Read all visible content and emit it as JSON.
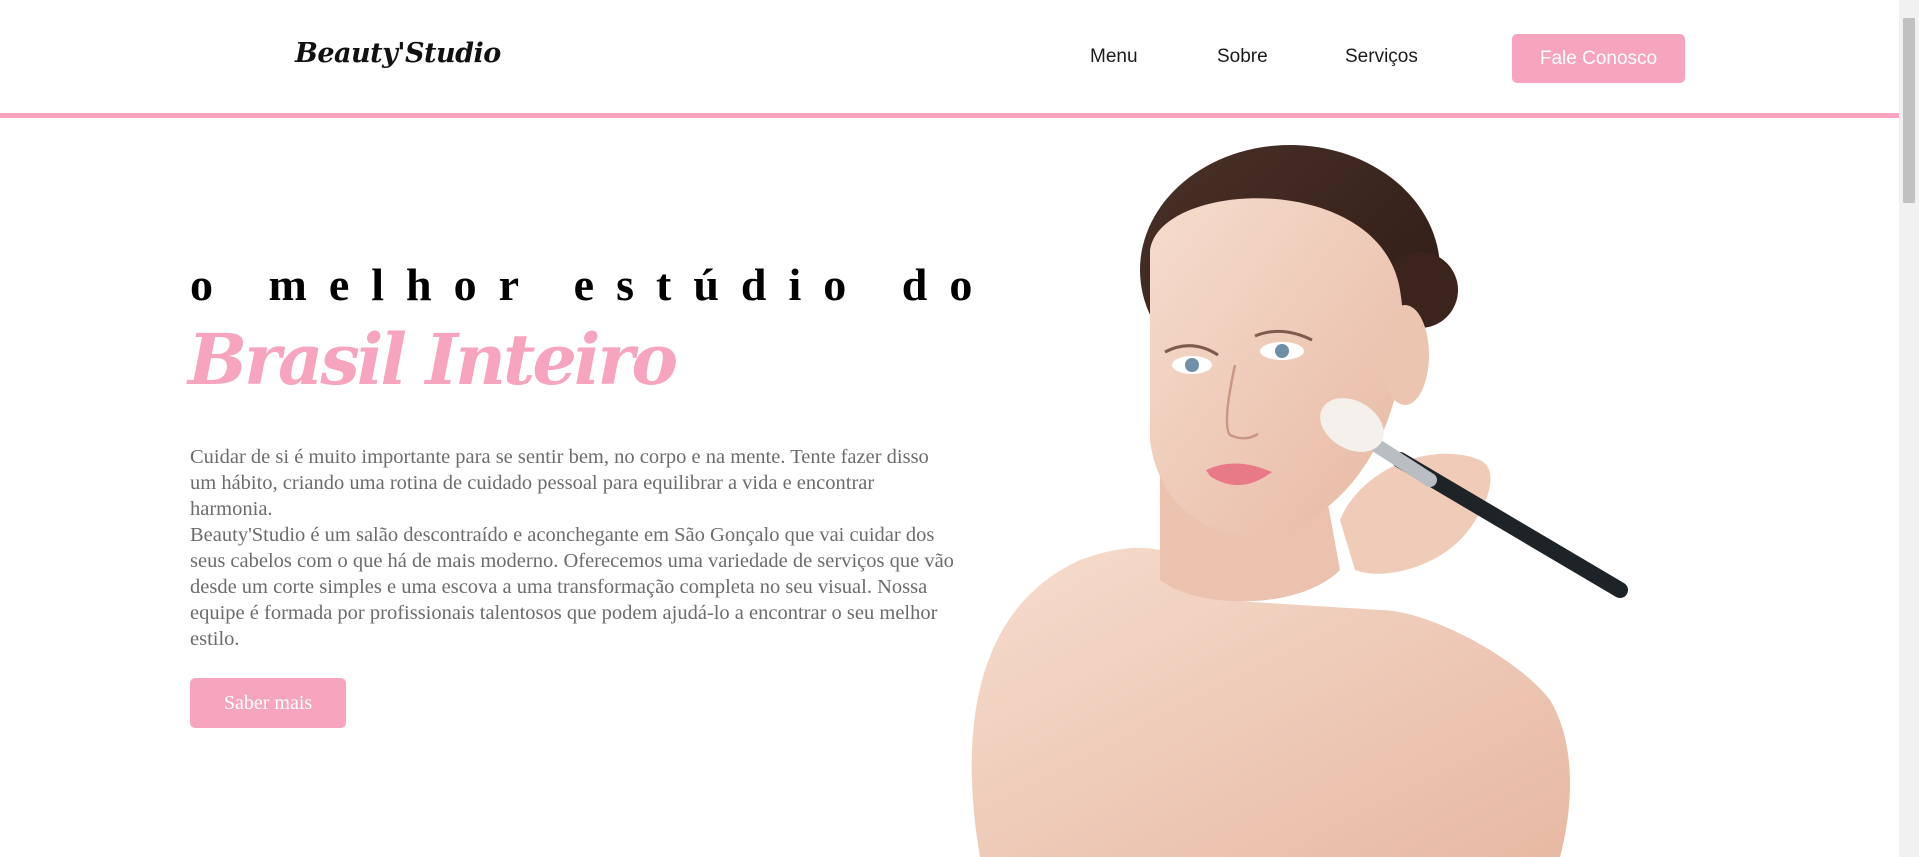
{
  "header": {
    "logo": "Beauty'Studio",
    "nav": [
      "Menu",
      "Sobre",
      "Serviços"
    ],
    "cta_label": "Fale Conosco"
  },
  "hero": {
    "title": "o melhor estúdio do",
    "accent": "Brasil Inteiro",
    "paragraph_1": "Cuidar de si é muito importante para se sentir bem, no corpo e na mente. Tente fazer disso um hábito, criando uma rotina de cuidado pessoal para equilibrar a vida e encontrar harmonia.",
    "paragraph_2": "Beauty'Studio é um salão descontraído e aconchegante em São Gonçalo que vai cuidar dos seus cabelos com o que há de mais moderno. Oferecemos uma variedade de serviços que vão desde um corte simples e uma escova a uma transformação completa no seu visual. Nossa equipe é formada por profissionais talentosos que podem ajudá-lo a encontrar o seu melhor estilo.",
    "button_label": "Saber mais"
  },
  "colors": {
    "accent": "#f7a5bf",
    "text": "#6c6c6c",
    "heading": "#000000"
  }
}
